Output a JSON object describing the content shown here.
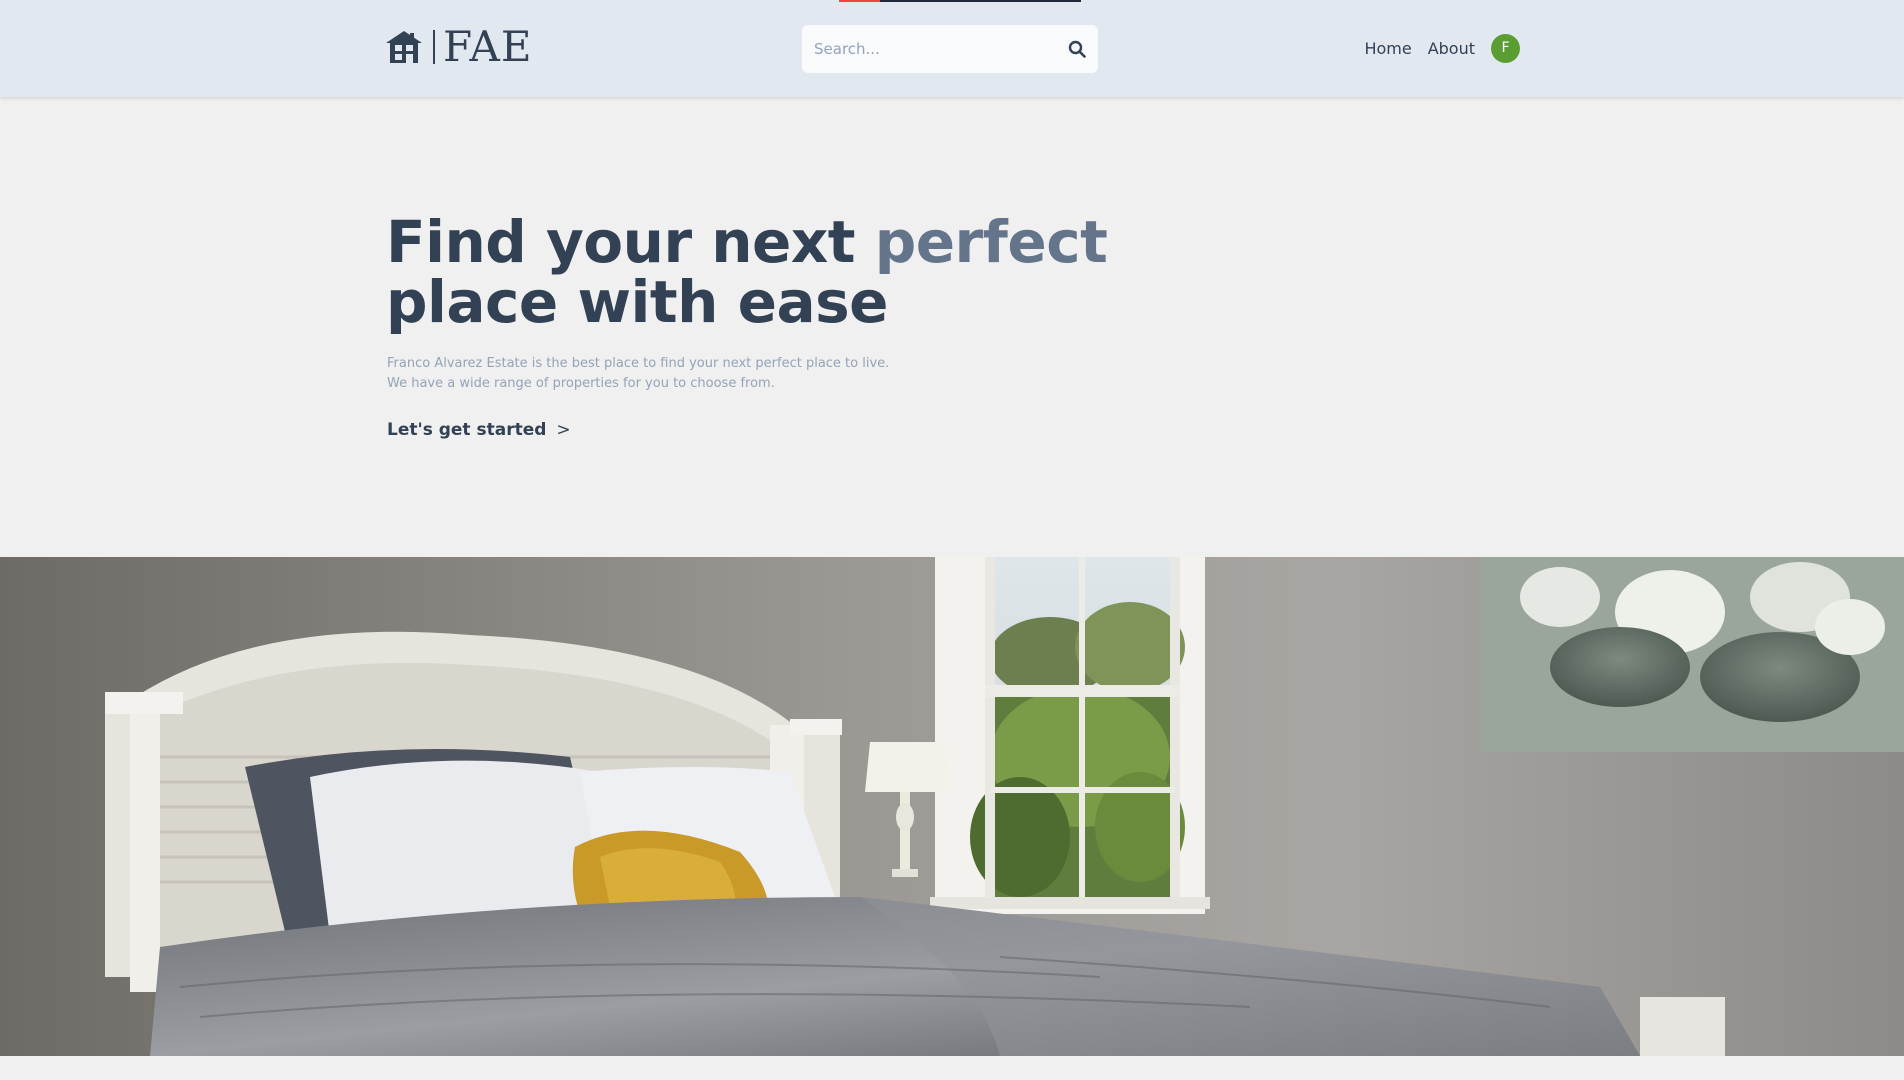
{
  "header": {
    "logo_text": "FAE",
    "logo_icon": "house-icon",
    "progress_fraction": 0.17,
    "progress_color": "#ef4444",
    "search": {
      "placeholder": "Search...",
      "value": "",
      "icon": "search-icon"
    },
    "nav": {
      "home_label": "Home",
      "about_label": "About"
    },
    "avatar": {
      "initial": "F",
      "color": "#5a9e33"
    }
  },
  "hero": {
    "title_part1": "Find your next ",
    "title_accent": "perfect",
    "title_part2": "place with ease",
    "description_line1": "Franco Alvarez Estate is the best place to find your next perfect place to live.",
    "description_line2": "We have a wide range of properties for you to choose from.",
    "cta_label": "Let's get started",
    "cta_arrow": ">"
  },
  "colors": {
    "header_bg": "#e2e8f0",
    "page_bg": "#f0f0f0",
    "text_primary": "#334155",
    "text_accent": "#64748b",
    "text_muted": "#94a3b8"
  }
}
